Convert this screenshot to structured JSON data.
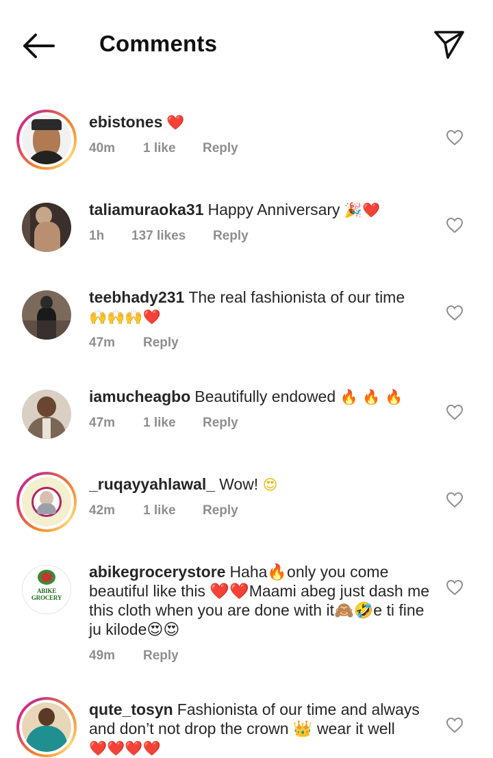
{
  "header": {
    "back_icon": "arrow-left-icon",
    "title": "Comments",
    "share_icon": "paper-plane-icon"
  },
  "comments": [
    {
      "username": "ebistones",
      "text": "",
      "emoji": "❤️",
      "time": "40m",
      "likes": "1 like",
      "reply": "Reply",
      "story_ring": true
    },
    {
      "username": "taliamuraoka31",
      "text": "Happy Anniversary",
      "emoji": "🎉❤️",
      "time": "1h",
      "likes": "137 likes",
      "reply": "Reply",
      "story_ring": false
    },
    {
      "username": "teebhady231",
      "text": "The real fashionista of our time",
      "emoji": "🙌🙌🙌❤️",
      "time": "47m",
      "likes": "",
      "reply": "Reply",
      "story_ring": false
    },
    {
      "username": "iamucheagbo",
      "text": "Beautifully endowed",
      "emoji": "🔥 🔥 🔥",
      "time": "47m",
      "likes": "1 like",
      "reply": "Reply",
      "story_ring": false
    },
    {
      "username": "_ruqayyahlawal_",
      "text": "Wow!",
      "emoji": "😍",
      "time": "42m",
      "likes": "1 like",
      "reply": "Reply",
      "story_ring": true
    },
    {
      "username": "abikegrocerystore",
      "text": "Haha🔥only you come beautiful like this ❤️❤️Maami abeg just dash me this cloth when you are done with it🙈🤣e ti fine ju kilode😍😍",
      "emoji": "",
      "time": "49m",
      "likes": "",
      "reply": "Reply",
      "story_ring": false,
      "avatar_logo_text": "ABIKE GROCERY"
    },
    {
      "username": "qute_tosyn",
      "text": "Fashionista of our time and always and don’t not drop the crown 👑 wear it well",
      "emoji": "❤️❤️❤️❤️",
      "time": "",
      "likes": "",
      "reply": "",
      "story_ring": true
    }
  ],
  "icons": {
    "like": "heart-outline-icon"
  },
  "colors": {
    "heart": "#e0142b",
    "meta": "#8e8e8e",
    "ring_start": "#f58529",
    "ring_end": "#c13584"
  }
}
